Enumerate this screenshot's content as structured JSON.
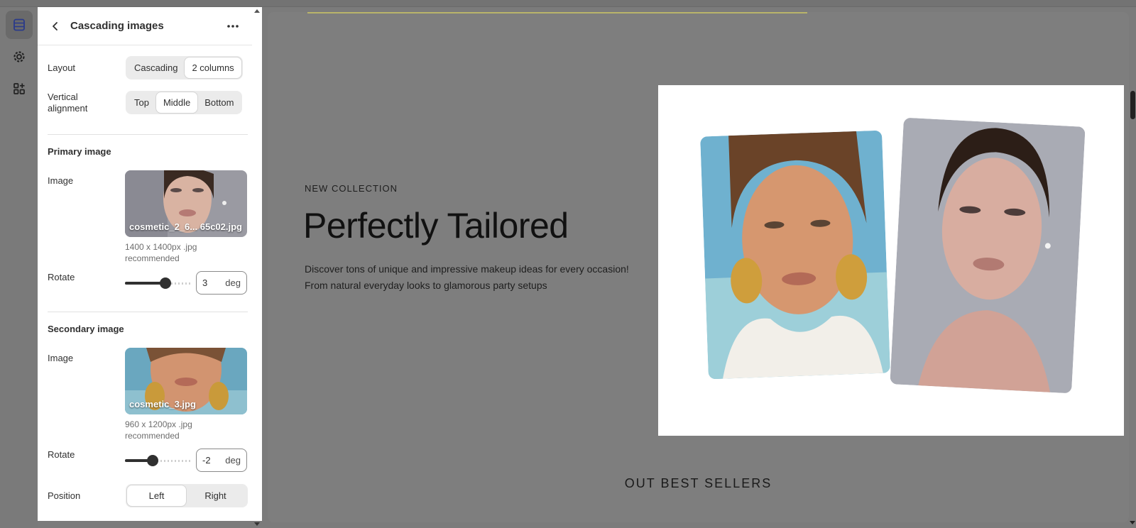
{
  "panel": {
    "title": "Cascading images",
    "layout": {
      "label": "Layout",
      "options": [
        "Cascading",
        "2 columns"
      ],
      "selected": "2 columns"
    },
    "valign": {
      "label": "Vertical alignment",
      "options": [
        "Top",
        "Middle",
        "Bottom"
      ],
      "selected": "Middle"
    },
    "primary": {
      "section": "Primary image",
      "image_label": "Image",
      "file": "cosmetic_2_6... 65c02.jpg",
      "hint": "1400 x 1400px .jpg recommended",
      "rotate_label": "Rotate",
      "rotate_value": "3",
      "rotate_unit": "deg",
      "rotate_fraction": 0.62
    },
    "secondary": {
      "section": "Secondary image",
      "image_label": "Image",
      "file": "cosmetic_3.jpg",
      "hint": "960 x 1200px .jpg recommended",
      "rotate_label": "Rotate",
      "rotate_value": "-2",
      "rotate_unit": "deg",
      "rotate_fraction": 0.42
    },
    "position": {
      "label": "Position",
      "options": [
        "Left",
        "Right"
      ],
      "selected": "Left"
    }
  },
  "preview": {
    "eyebrow": "NEW COLLECTION",
    "headline": "Perfectly Tailored",
    "body": "Discover tons of unique and impressive makeup ideas for every occasion! From natural everyday looks to glamorous party setups",
    "next_section": "OUT BEST SELLERS"
  },
  "icons": [
    "sections-icon",
    "gear-icon",
    "apps-add-icon",
    "back-arrow-icon",
    "more-icon"
  ],
  "colors": {
    "accent": "#303030",
    "overlay": "#7b7b7b",
    "panel": "#ffffff"
  }
}
